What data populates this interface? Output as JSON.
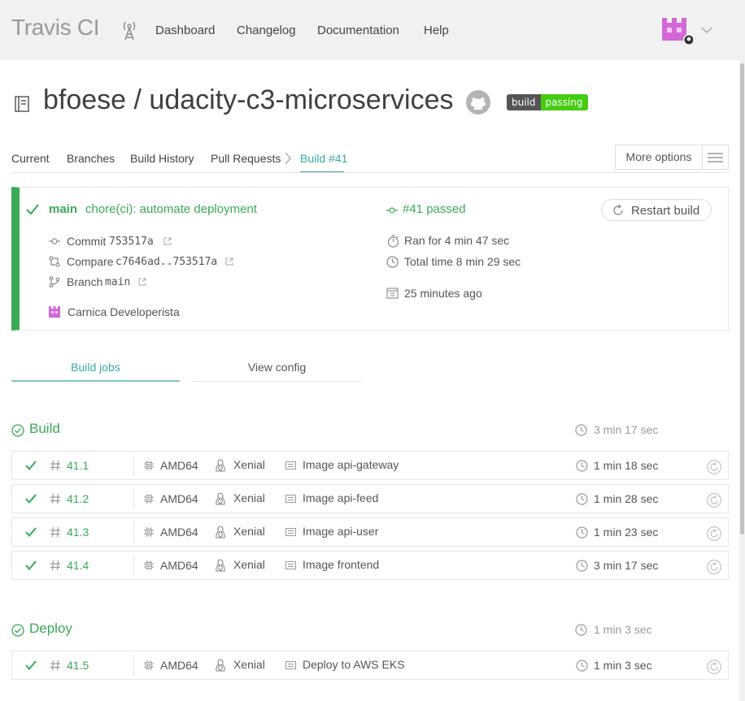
{
  "nav": {
    "brand": "Travis CI",
    "links": [
      "Dashboard",
      "Changelog",
      "Documentation",
      "Help"
    ]
  },
  "repo": {
    "title": "bfoese / udacity-c3-microservices",
    "badge_left": "build",
    "badge_right": "passing"
  },
  "tabs": [
    "Current",
    "Branches",
    "Build History",
    "Pull Requests",
    "Build #41"
  ],
  "more_options": "More options",
  "build": {
    "branch": "main",
    "message": "chore(ci): automate deployment",
    "status": "#41 passed",
    "restart_label": "Restart build",
    "commit_label": "Commit",
    "commit": "753517a",
    "compare_label": "Compare",
    "compare": "c7646ad..753517a",
    "branch_label": "Branch",
    "branch_value": "main",
    "author": "Carnica Developerista",
    "ran_for": "Ran for 4 min 47 sec",
    "total_time": "Total time 8 min 29 sec",
    "finished": "25 minutes ago"
  },
  "job_tabs": [
    "Build jobs",
    "View config"
  ],
  "stages": [
    {
      "title": "Build",
      "duration": "3 min 17 sec",
      "jobs": [
        {
          "number": "41.1",
          "arch": "AMD64",
          "os": "Xenial",
          "name": "Image api-gateway",
          "duration": "1 min 18 sec"
        },
        {
          "number": "41.2",
          "arch": "AMD64",
          "os": "Xenial",
          "name": "Image api-feed",
          "duration": "1 min 28 sec"
        },
        {
          "number": "41.3",
          "arch": "AMD64",
          "os": "Xenial",
          "name": "Image api-user",
          "duration": "1 min 23 sec"
        },
        {
          "number": "41.4",
          "arch": "AMD64",
          "os": "Xenial",
          "name": "Image frontend",
          "duration": "3 min 17 sec"
        }
      ]
    },
    {
      "title": "Deploy",
      "duration": "1 min 3 sec",
      "jobs": [
        {
          "number": "41.5",
          "arch": "AMD64",
          "os": "Xenial",
          "name": "Deploy to AWS EKS",
          "duration": "1 min 3 sec"
        }
      ]
    }
  ],
  "colors": {
    "passed": "#39aa56",
    "accent": "#39aaa4",
    "badge_passing": "#44cc11",
    "topbar": "#f1f1f1"
  },
  "icons": {
    "tower": "broadcast-tower-icon",
    "avatar": "invader-avatar-icon",
    "github": "github-icon",
    "repo": "repo-book-icon",
    "check": "check-icon",
    "commit": "commit-icon",
    "compare": "compare-icon",
    "branch": "branch-icon",
    "external": "external-link-icon",
    "stopwatch": "stopwatch-icon",
    "clock": "clock-icon",
    "calendar": "calendar-icon",
    "restart": "restart-icon",
    "cpu": "cpu-icon",
    "linux": "tux-icon",
    "env": "env-icon",
    "hash": "hash-icon"
  }
}
